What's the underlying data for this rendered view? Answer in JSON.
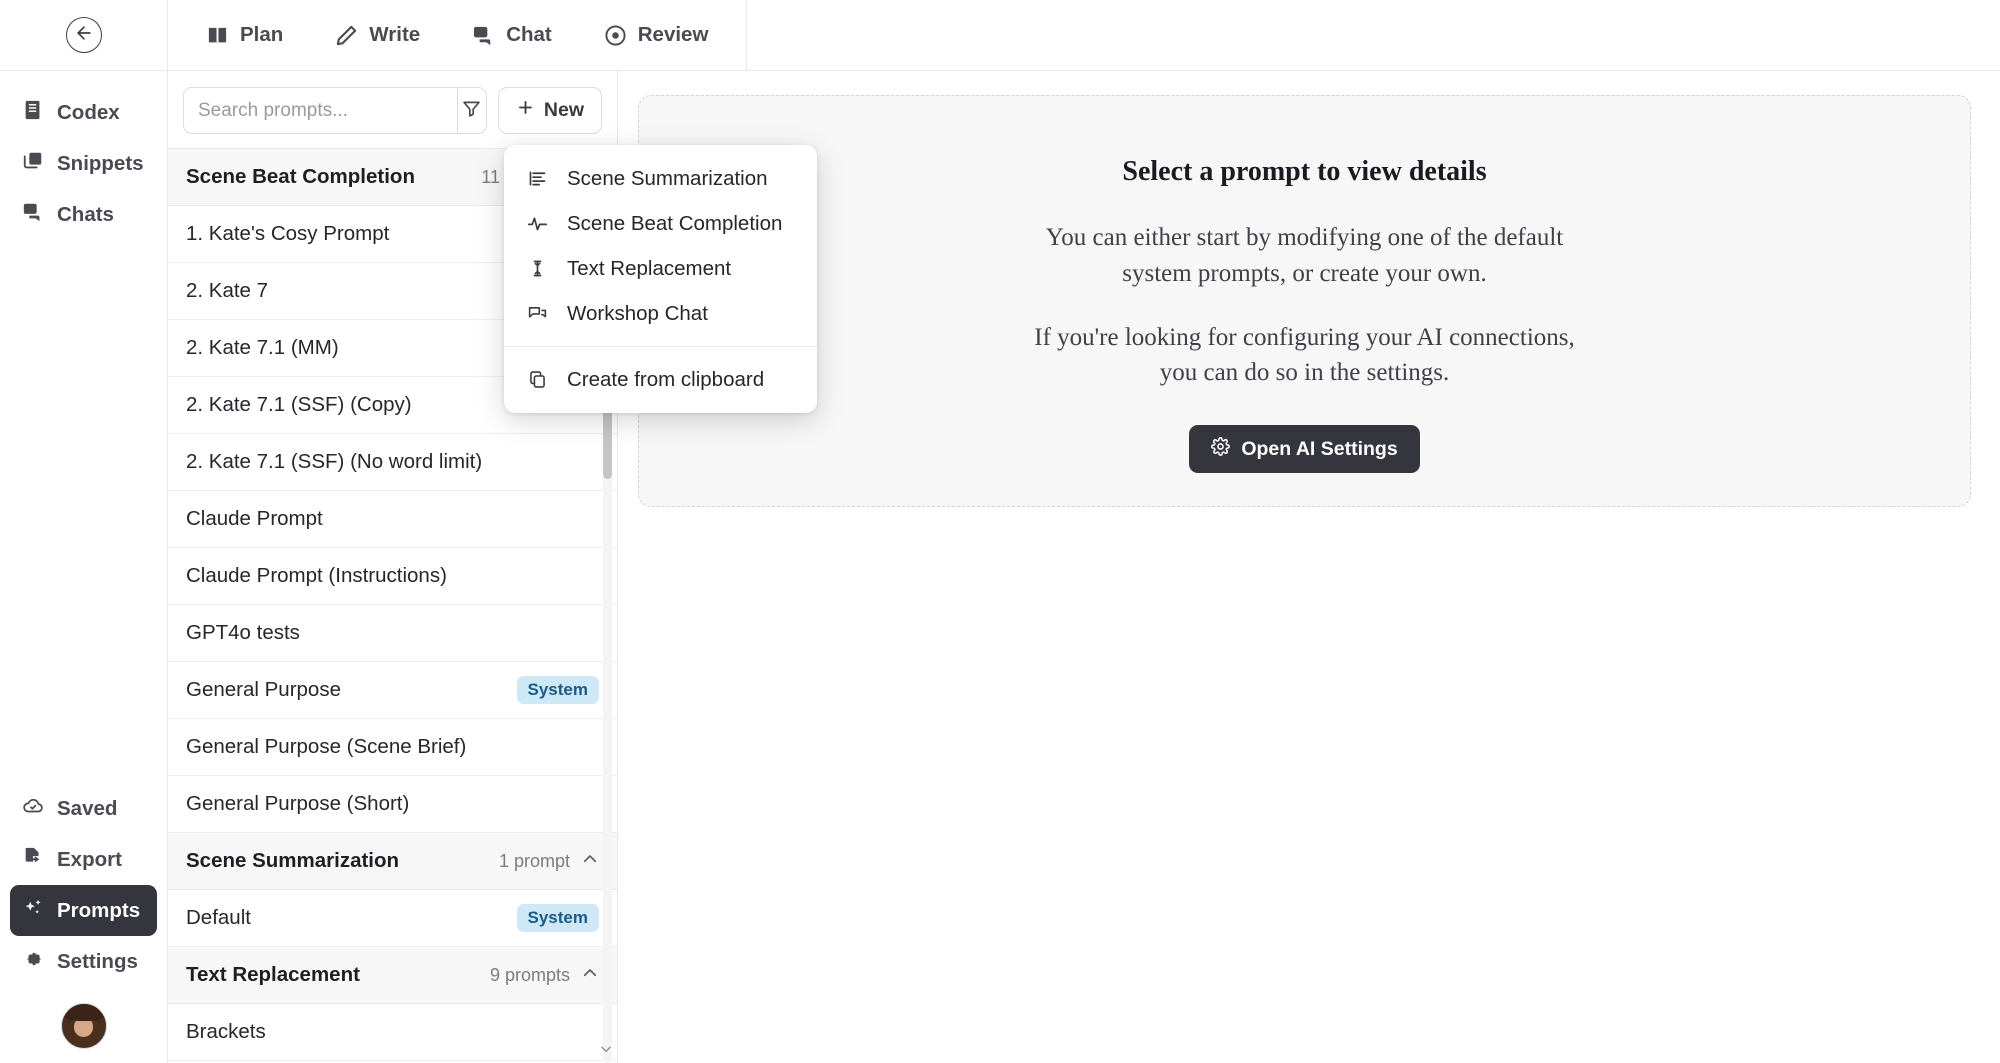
{
  "topbar": {
    "back_icon": "arrow-left-circle-icon",
    "tabs": [
      {
        "label": "Plan",
        "icon": "book-open-icon"
      },
      {
        "label": "Write",
        "icon": "pencil-icon"
      },
      {
        "label": "Chat",
        "icon": "chat-bubbles-icon"
      },
      {
        "label": "Review",
        "icon": "eye-icon"
      }
    ]
  },
  "rail": {
    "top_items": [
      {
        "label": "Codex",
        "icon": "book-icon",
        "active": false
      },
      {
        "label": "Snippets",
        "icon": "layers-icon",
        "active": false
      },
      {
        "label": "Chats",
        "icon": "chat-bubbles-icon",
        "active": false
      }
    ],
    "bottom_items": [
      {
        "label": "Saved",
        "icon": "cloud-check-icon",
        "active": false
      },
      {
        "label": "Export",
        "icon": "file-export-icon",
        "active": false
      },
      {
        "label": "Prompts",
        "icon": "sparkles-icon",
        "active": true
      },
      {
        "label": "Settings",
        "icon": "gear-icon",
        "active": false
      }
    ],
    "avatar": "user-avatar"
  },
  "toolbar": {
    "search_placeholder": "Search prompts...",
    "search_value": "",
    "filter_icon": "filter-icon",
    "new_label": "New",
    "new_icon": "plus-icon"
  },
  "list": {
    "groups": [
      {
        "title": "Scene Beat Completion",
        "count": "11 prompts",
        "collapse_icon": "chevron-up-icon",
        "rows": [
          {
            "label": "1. Kate's Cosy Prompt",
            "badge": ""
          },
          {
            "label": "2. Kate 7",
            "badge": ""
          },
          {
            "label": "2. Kate 7.1 (MM)",
            "badge": ""
          },
          {
            "label": "2. Kate 7.1 (SSF) (Copy)",
            "badge": ""
          },
          {
            "label": "2. Kate 7.1 (SSF) (No word limit)",
            "badge": ""
          },
          {
            "label": "Claude Prompt",
            "badge": ""
          },
          {
            "label": "Claude Prompt (Instructions)",
            "badge": ""
          },
          {
            "label": "GPT4o tests",
            "badge": ""
          },
          {
            "label": "General Purpose",
            "badge": "System"
          },
          {
            "label": "General Purpose (Scene Brief)",
            "badge": ""
          },
          {
            "label": "General Purpose (Short)",
            "badge": ""
          }
        ]
      },
      {
        "title": "Scene Summarization",
        "count": "1 prompt",
        "collapse_icon": "chevron-up-icon",
        "rows": [
          {
            "label": "Default",
            "badge": "System"
          }
        ]
      },
      {
        "title": "Text Replacement",
        "count": "9 prompts",
        "collapse_icon": "chevron-up-icon",
        "rows": [
          {
            "label": "Brackets",
            "badge": ""
          }
        ]
      }
    ]
  },
  "dropdown": {
    "items": [
      {
        "label": "Scene Summarization",
        "icon": "align-left-icon"
      },
      {
        "label": "Scene Beat Completion",
        "icon": "activity-pulse-icon"
      },
      {
        "label": "Text Replacement",
        "icon": "text-cursor-icon"
      },
      {
        "label": "Workshop Chat",
        "icon": "chat-bubbles-icon"
      }
    ],
    "footer": {
      "label": "Create from clipboard",
      "icon": "clipboard-copy-icon"
    }
  },
  "detail": {
    "title": "Select a prompt to view details",
    "paragraph1": "You can either start by modifying one of the default system prompts, or create your own.",
    "paragraph2": "If you're looking for configuring your AI connections, you can do so in the settings.",
    "button_label": "Open AI Settings",
    "button_icon": "gear-icon"
  },
  "colors": {
    "accent_dark": "#35353d",
    "badge_bg": "#cfe8f6",
    "badge_text": "#1b5b8a",
    "border": "#e9e9ec"
  }
}
